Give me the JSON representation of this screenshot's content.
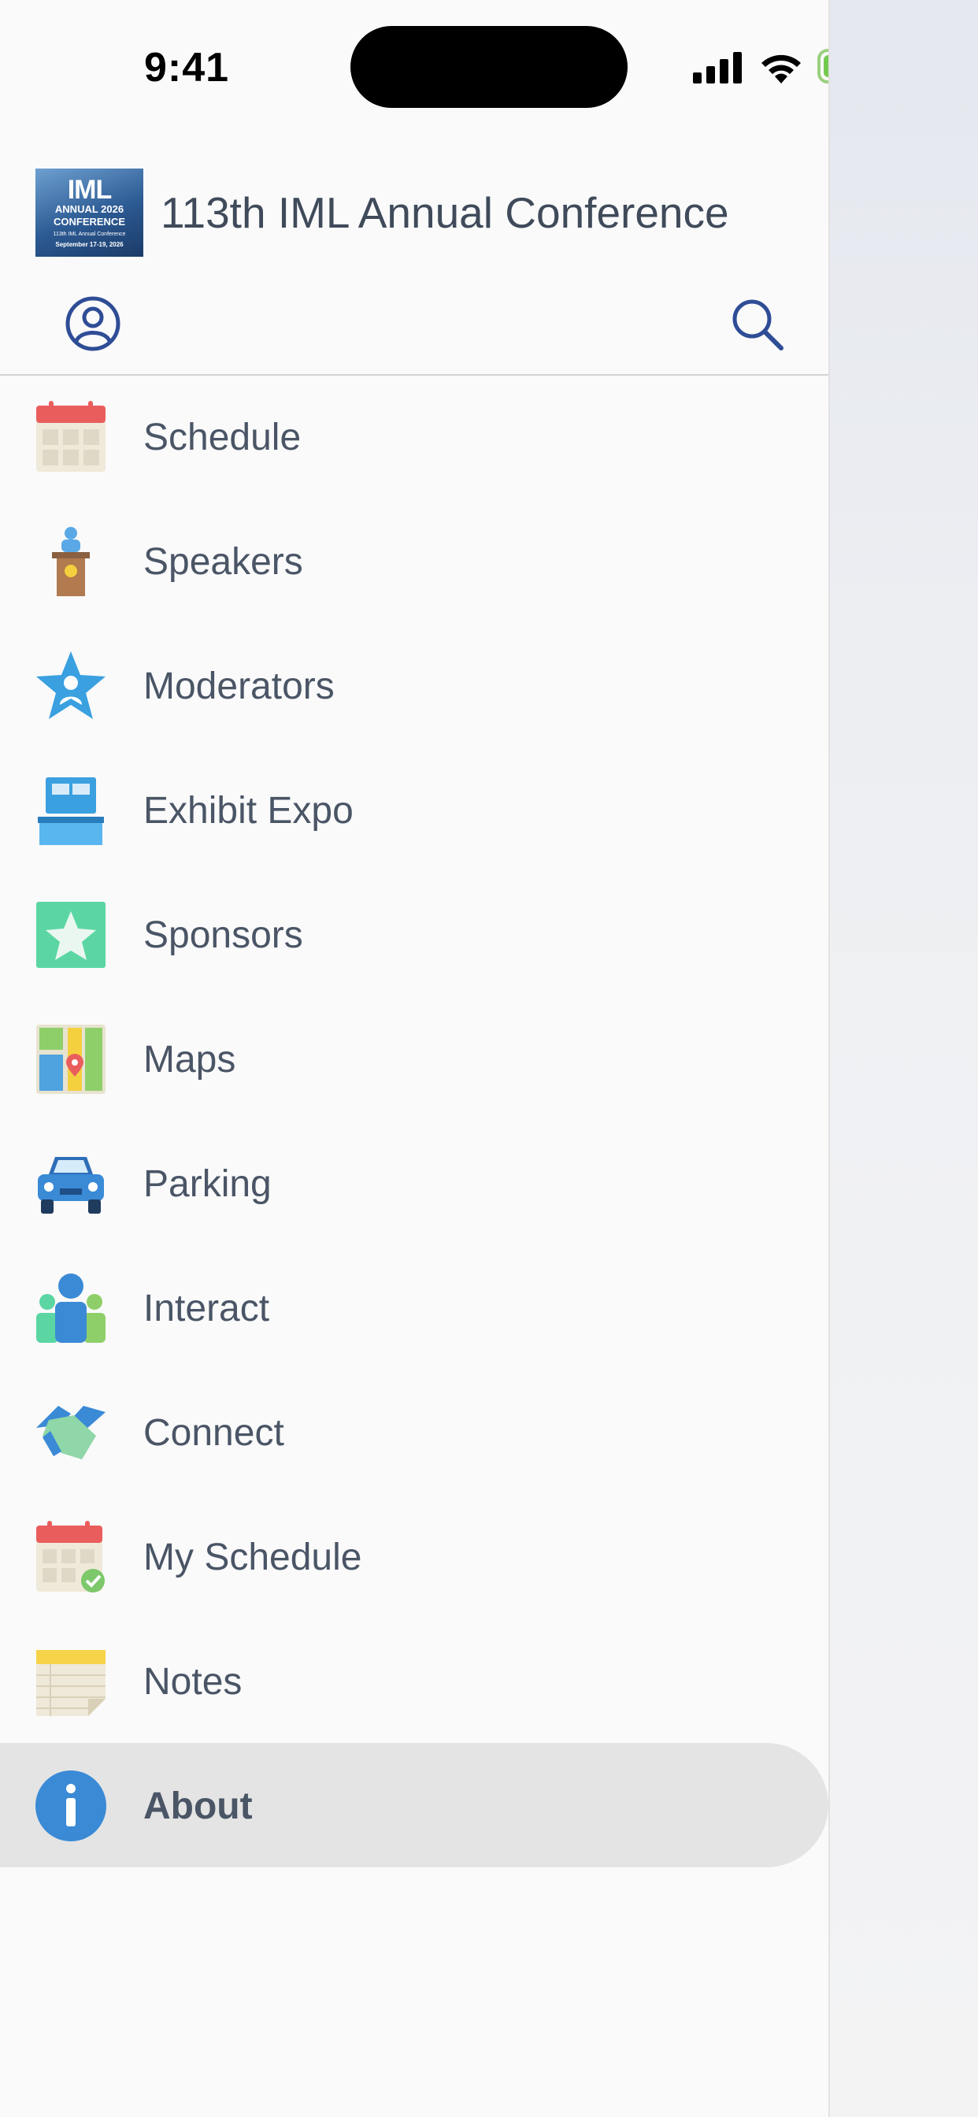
{
  "status_bar": {
    "time": "9:41"
  },
  "header": {
    "app_title": "113th IML Annual Conference"
  },
  "logo": {
    "line1": "IML",
    "line2": "ANNUAL 2026",
    "line3": "CONFERENCE",
    "line4": "113th IML Annual Conference",
    "line5": "September 17-19, 2026"
  },
  "menu": {
    "items": [
      {
        "label": "Schedule",
        "icon": "calendar-icon"
      },
      {
        "label": "Speakers",
        "icon": "podium-icon"
      },
      {
        "label": "Moderators",
        "icon": "star-person-icon"
      },
      {
        "label": "Exhibit Expo",
        "icon": "booth-icon"
      },
      {
        "label": "Sponsors",
        "icon": "star-badge-icon"
      },
      {
        "label": "Maps",
        "icon": "map-icon"
      },
      {
        "label": "Parking",
        "icon": "car-icon"
      },
      {
        "label": "Interact",
        "icon": "people-icon"
      },
      {
        "label": "Connect",
        "icon": "handshake-icon"
      },
      {
        "label": "My Schedule",
        "icon": "calendar-check-icon"
      },
      {
        "label": "Notes",
        "icon": "notepad-icon"
      },
      {
        "label": "About",
        "icon": "info-icon"
      }
    ],
    "active": "About"
  },
  "colors": {
    "accent": "#2f4d96",
    "text": "#4a5566",
    "active_bg": "#e4e4e4"
  }
}
